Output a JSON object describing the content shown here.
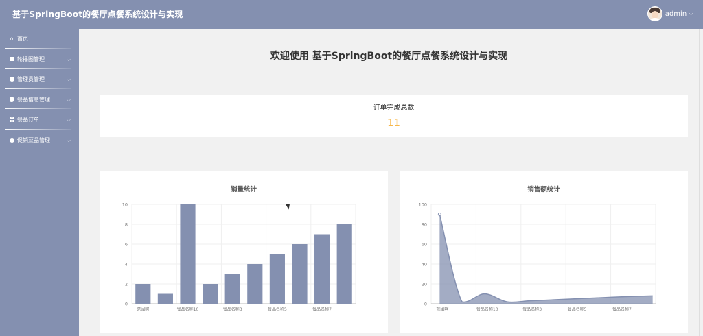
{
  "app": {
    "title": "基于SpringBoot的餐厅点餐系统设计与实现",
    "user": "admin",
    "caret": "⌵"
  },
  "sidebar": {
    "items": [
      {
        "label": "首页",
        "icon": "home-icon",
        "has_chevron": false
      },
      {
        "label": "轮播图管理",
        "icon": "image-icon",
        "has_chevron": true
      },
      {
        "label": "管理员管理",
        "icon": "user-icon",
        "has_chevron": true
      },
      {
        "label": "餐品信息管理",
        "icon": "database-icon",
        "has_chevron": true
      },
      {
        "label": "餐品订单",
        "icon": "grid-icon",
        "has_chevron": true
      },
      {
        "label": "促销菜品管理",
        "icon": "flower-icon",
        "has_chevron": true
      }
    ]
  },
  "main": {
    "welcome": "欢迎使用 基于SpringBoot的餐厅点餐系统设计与实现",
    "stat": {
      "label": "订单完成总数",
      "value": "11"
    },
    "colors": {
      "accent": "#8490b0",
      "value": "#f7b84b"
    }
  },
  "chart_data": [
    {
      "type": "bar",
      "title": "销量统计",
      "categories": [
        "范围啊",
        "",
        "餐品名称10",
        "",
        "餐品名称3",
        "",
        "餐品名称5",
        "",
        "餐品名称7",
        ""
      ],
      "values": [
        2,
        1,
        10,
        2,
        3,
        4,
        5,
        6,
        7,
        8
      ],
      "ylim": [
        0,
        10
      ],
      "yticks": [
        0,
        2,
        4,
        6,
        8,
        10
      ],
      "color": "#8490b0"
    },
    {
      "type": "area",
      "title": "销售额统计",
      "categories": [
        "范围啊",
        "",
        "餐品名称10",
        "",
        "餐品名称3",
        "",
        "餐品名称5",
        "",
        "餐品名称7",
        ""
      ],
      "values": [
        90,
        2,
        10,
        2,
        3,
        4,
        5,
        6,
        7,
        8
      ],
      "ylim": [
        0,
        100
      ],
      "yticks": [
        0,
        20,
        40,
        60,
        80,
        100
      ],
      "color": "#8490b0"
    }
  ]
}
